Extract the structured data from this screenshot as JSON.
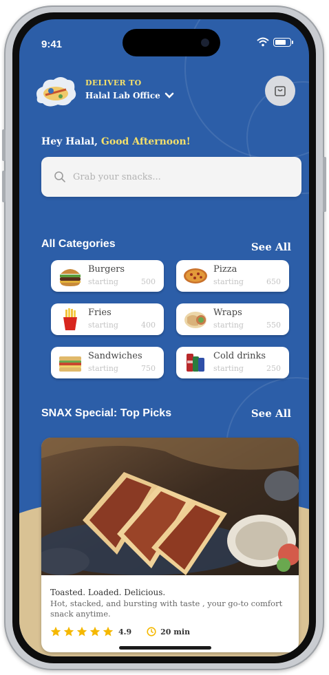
{
  "status_bar": {
    "time": "9:41"
  },
  "header": {
    "deliver_label": "DELIVER TO",
    "address": "Halal Lab Office"
  },
  "greeting": {
    "name_part": "Hey Halal,",
    "time_part": "Good Afternoon!"
  },
  "search": {
    "placeholder": "Grab your snacks..."
  },
  "categories": {
    "title": "All Categories",
    "see_all": "See All",
    "items": [
      {
        "name": "Burgers",
        "starting": "starting",
        "price": "500"
      },
      {
        "name": "Pizza",
        "starting": "starting",
        "price": "650"
      },
      {
        "name": "Fries",
        "starting": "starting",
        "price": "400"
      },
      {
        "name": "Wraps",
        "starting": "starting",
        "price": "550"
      },
      {
        "name": "Sandwiches",
        "starting": "starting",
        "price": "750"
      },
      {
        "name": "Cold drinks",
        "starting": "starting",
        "price": "250"
      }
    ]
  },
  "top_picks": {
    "title": "SNAX Special: Top Picks",
    "see_all": "See All",
    "card": {
      "headline": "Toasted. Loaded. Delicious.",
      "description": "Hot, stacked, and bursting with taste , your go-to comfort snack anytime.",
      "rating": "4.9",
      "stars": 5,
      "eta": "20 min"
    }
  },
  "colors": {
    "primary": "#2c5ea8",
    "accent": "#f4e06a",
    "beige": "#d9c294",
    "star": "#f5b800"
  }
}
